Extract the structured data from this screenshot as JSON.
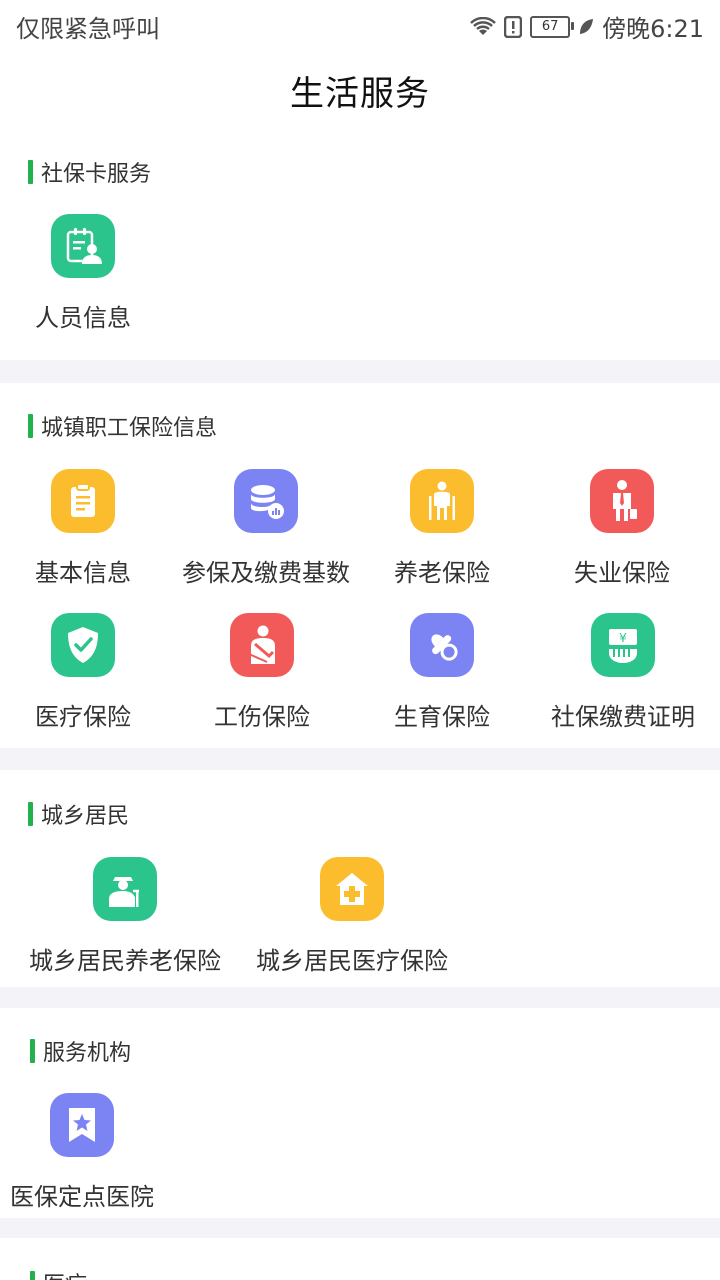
{
  "status_bar": {
    "carrier": "仅限紧急呼叫",
    "battery": "67",
    "time": "傍晚6:21",
    "icons": [
      "wifi-icon",
      "alert-icon",
      "battery-icon",
      "leaf-icon"
    ]
  },
  "header": {
    "title": "生活服务"
  },
  "sections": {
    "social_card": {
      "title": "社保卡服务",
      "items": [
        "人员信息"
      ]
    },
    "employee": {
      "title": "城镇职工保险信息",
      "items": [
        "基本信息",
        "参保及缴费基数",
        "养老保险",
        "失业保险",
        "医疗保险",
        "工伤保险",
        "生育保险",
        "社保缴费证明"
      ]
    },
    "resident": {
      "title": "城乡居民",
      "items": [
        "城乡居民养老保险",
        "城乡居民医疗保险"
      ]
    },
    "institution": {
      "title": "服务机构",
      "items": [
        "医保定点医院"
      ]
    },
    "partial": {
      "title": "医疗"
    }
  },
  "colors": {
    "green": "#2bc48c",
    "orange": "#fbbd2e",
    "purple": "#7c83f3",
    "red": "#f25a5a",
    "accent_bar": "#22b14c"
  }
}
